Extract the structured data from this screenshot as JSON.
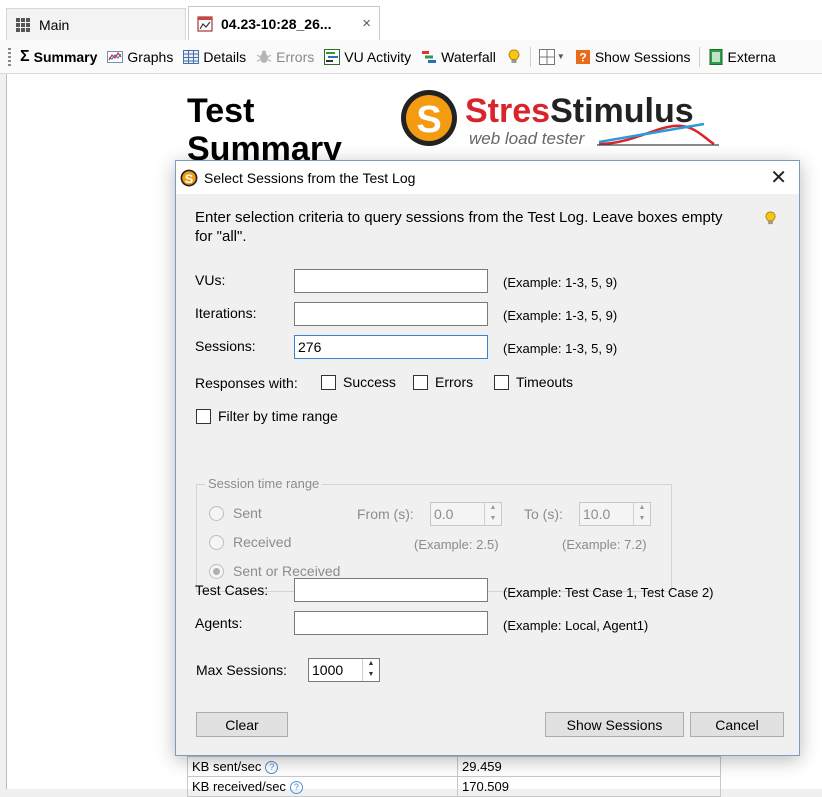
{
  "tabs": [
    {
      "label": "Main",
      "icon": "grid-icon"
    },
    {
      "label": "04.23-10:28_26...",
      "icon": "chart-document-icon",
      "close": "×"
    }
  ],
  "toolbar": {
    "summary": "Summary",
    "graphs": "Graphs",
    "details": "Details",
    "errors": "Errors",
    "vu_activity": "VU Activity",
    "waterfall": "Waterfall",
    "show_sessions": "Show Sessions",
    "external": "Externa"
  },
  "report": {
    "title_line1": "Test",
    "title_line2": "Summary",
    "logo_name_a": "Stres",
    "logo_name_b": "Stimulus",
    "logo_tagline": "web load tester",
    "logo_mark": "S",
    "rows": [
      {
        "label": "KB sent/sec",
        "value": "29.459"
      },
      {
        "label": "KB received/sec",
        "value": "170.509"
      }
    ],
    "help_glyph": "?"
  },
  "dialog": {
    "title": "Select Sessions from the Test Log",
    "close": "✕",
    "intro": "Enter selection criteria to query sessions from the Test Log. Leave boxes empty for \"all\".",
    "vus_label": "VUs:",
    "vus_value": "",
    "vus_example": "(Example: 1-3, 5, 9)",
    "iterations_label": "Iterations:",
    "iterations_value": "",
    "iterations_example": "(Example: 1-3, 5, 9)",
    "sessions_label": "Sessions:",
    "sessions_value": "276",
    "sessions_example": "(Example: 1-3, 5, 9)",
    "responses_label": "Responses with:",
    "success_label": "Success",
    "errors_label": "Errors",
    "timeouts_label": "Timeouts",
    "filter_time_label": "Filter by time range",
    "time_group_label": "Session time range",
    "sent_label": "Sent",
    "received_label": "Received",
    "sent_or_received_label": "Sent or Received",
    "from_label": "From (s):",
    "from_value": "0.0",
    "from_example": "(Example: 2.5)",
    "to_label": "To (s):",
    "to_value": "10.0",
    "to_example": "(Example: 7.2)",
    "test_cases_label": "Test Cases:",
    "test_cases_value": "",
    "test_cases_example": "(Example: Test Case 1, Test Case 2)",
    "agents_label": "Agents:",
    "agents_value": "",
    "agents_example": "(Example: Local, Agent1)",
    "max_sessions_label": "Max Sessions:",
    "max_sessions_value": "1000",
    "clear_button": "Clear",
    "show_sessions_button": "Show Sessions",
    "cancel_button": "Cancel"
  },
  "colors": {
    "logo_orange": "#f39c12",
    "logo_red": "#d9242b",
    "accent_blue": "#3d7fd0"
  }
}
